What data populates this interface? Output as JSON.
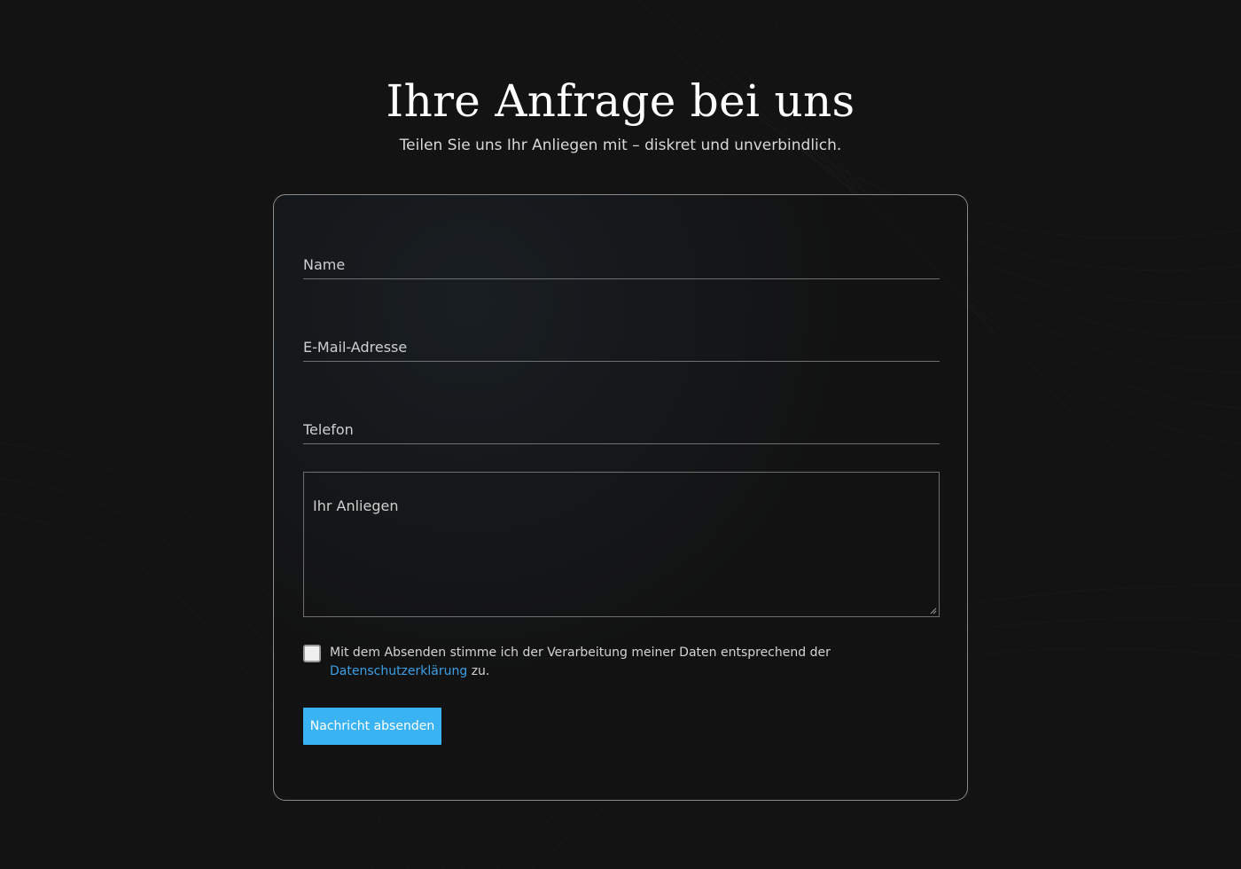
{
  "header": {
    "title": "Ihre Anfrage bei uns",
    "subtitle": "Teilen Sie uns Ihr Anliegen mit – diskret und unverbindlich."
  },
  "form": {
    "name_placeholder": "Name",
    "email_placeholder": "E-Mail-Adresse",
    "phone_placeholder": "Telefon",
    "message_placeholder": "Ihr Anliegen",
    "consent_text": "Mit dem Absenden stimme ich der Verarbeitung meiner Daten entsprechend der",
    "consent_link": "Datenschutzerklärung",
    "consent_suffix": "zu.",
    "consent_checked": false,
    "submit_label": "Nachricht absenden"
  },
  "colors": {
    "background": "#131313",
    "accent": "#3ab3f5",
    "link": "#3aa0e8"
  }
}
